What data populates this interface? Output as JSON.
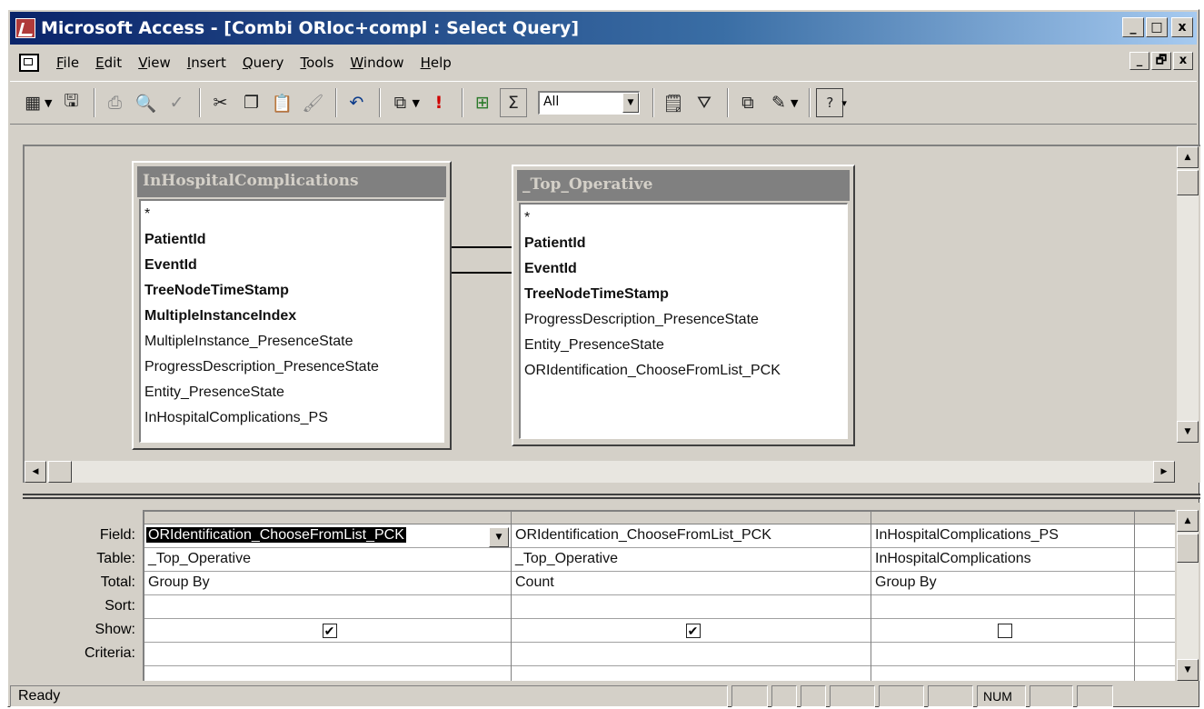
{
  "window": {
    "title": "Microsoft Access - [Combi ORloc+compl : Select Query]",
    "caption_buttons": [
      "_",
      "□",
      "x"
    ],
    "mdi_buttons": [
      "_",
      "🗗",
      "x"
    ]
  },
  "menu": {
    "items": [
      {
        "label": "File",
        "accel": "F"
      },
      {
        "label": "Edit",
        "accel": "E"
      },
      {
        "label": "View",
        "accel": "V"
      },
      {
        "label": "Insert",
        "accel": "I"
      },
      {
        "label": "Query",
        "accel": "Q"
      },
      {
        "label": "Tools",
        "accel": "T"
      },
      {
        "label": "Window",
        "accel": "W"
      },
      {
        "label": "Help",
        "accel": "H"
      }
    ]
  },
  "toolbar": {
    "top_values_value": "All",
    "icons": [
      "view-icon",
      "save-icon",
      "print-icon",
      "print-preview-icon",
      "spelling-icon",
      "cut-icon",
      "copy-icon",
      "paste-icon",
      "format-painter-icon",
      "undo-icon",
      "query-type-icon",
      "run-icon",
      "show-table-icon",
      "totals-icon",
      "properties-icon",
      "build-icon",
      "database-window-icon",
      "new-object-icon",
      "help-icon"
    ]
  },
  "tables": [
    {
      "title": "InHospitalComplications",
      "fields": [
        {
          "name": "*",
          "key": false
        },
        {
          "name": "PatientId",
          "key": true
        },
        {
          "name": "EventId",
          "key": true
        },
        {
          "name": "TreeNodeTimeStamp",
          "key": true
        },
        {
          "name": "MultipleInstanceIndex",
          "key": true
        },
        {
          "name": "MultipleInstance_PresenceState",
          "key": false
        },
        {
          "name": "ProgressDescription_PresenceState",
          "key": false
        },
        {
          "name": "Entity_PresenceState",
          "key": false
        },
        {
          "name": "InHospitalComplications_PS",
          "key": false
        }
      ]
    },
    {
      "title": "_Top_Operative",
      "fields": [
        {
          "name": "*",
          "key": false
        },
        {
          "name": "PatientId",
          "key": true
        },
        {
          "name": "EventId",
          "key": true
        },
        {
          "name": "TreeNodeTimeStamp",
          "key": true
        },
        {
          "name": "ProgressDescription_PresenceState",
          "key": false
        },
        {
          "name": "Entity_PresenceState",
          "key": false
        },
        {
          "name": "ORIdentification_ChooseFromList_PCK",
          "key": false
        }
      ]
    }
  ],
  "grid": {
    "row_labels": [
      "Field:",
      "Table:",
      "Total:",
      "Sort:",
      "Show:",
      "Criteria:"
    ],
    "columns": [
      {
        "field": "ORIdentification_ChooseFromList_PCK",
        "table": "_Top_Operative",
        "total": "Group By",
        "sort": "",
        "show": true,
        "criteria": ""
      },
      {
        "field": "ORIdentification_ChooseFromList_PCK",
        "table": "_Top_Operative",
        "total": "Count",
        "sort": "",
        "show": true,
        "criteria": ""
      },
      {
        "field": "InHospitalComplications_PS",
        "table": "InHospitalComplications",
        "total": "Group By",
        "sort": "",
        "show": false,
        "criteria": ""
      },
      {
        "field": "",
        "table": "",
        "total": "",
        "sort": "",
        "show": null,
        "criteria": ""
      }
    ]
  },
  "status": {
    "text": "Ready",
    "num_indicator": "NUM"
  },
  "colors": {
    "title_bar": "#0a246a",
    "window_face": "#d4d0c8",
    "table_title_bg": "#808080"
  }
}
